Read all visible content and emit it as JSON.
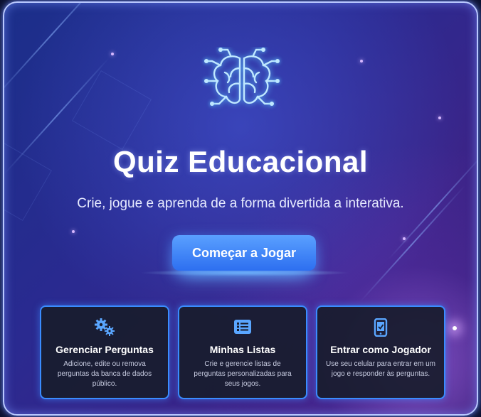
{
  "hero": {
    "title": "Quiz Educacional",
    "subtitle": "Crie, jogue e aprenda de a forma divertida a interativa.",
    "cta_label": "Começar a Jogar"
  },
  "cards": [
    {
      "icon": "gears-icon",
      "title": "Gerenciar Perguntas",
      "description": "Adicione, edite ou remova perguntas da banca de dados público."
    },
    {
      "icon": "list-icon",
      "title": "Minhas Listas",
      "description": "Crie e gerencie listas de perguntas personalizadas para seus jogos."
    },
    {
      "icon": "mobile-icon",
      "title": "Entrar como Jogador",
      "description": "Use seu celular para entrar em um jogo e responder às perguntas."
    }
  ],
  "colors": {
    "accent": "#3a8cff",
    "button": "#2d6ff0",
    "card_bg": "#181c2d",
    "icon": "#5aa6ff"
  }
}
